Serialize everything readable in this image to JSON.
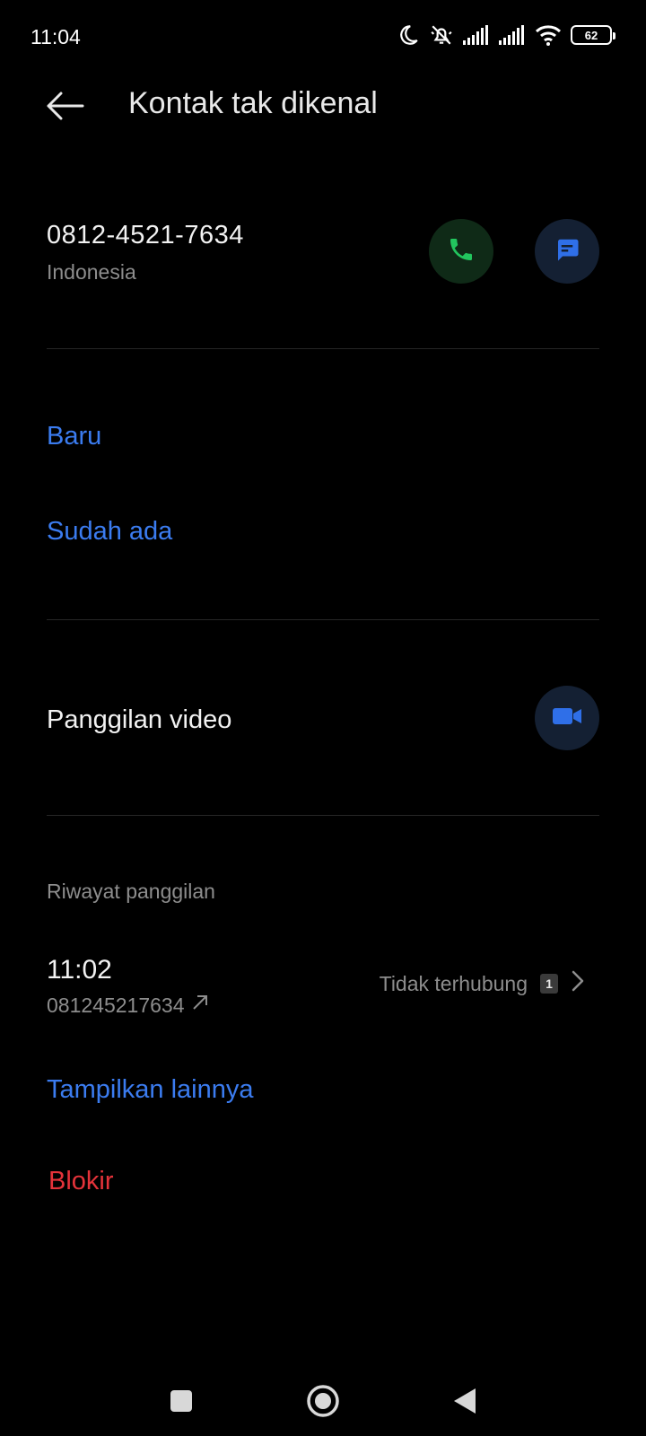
{
  "status_bar": {
    "time": "11:04",
    "battery": "62",
    "icons": [
      "moon-icon",
      "silent-icon",
      "signal-icon",
      "signal-icon",
      "wifi-icon",
      "battery-icon"
    ]
  },
  "header": {
    "title": "Kontak tak dikenal",
    "back_icon": "arrow-left-icon"
  },
  "contact": {
    "number": "0812-4521-7634",
    "region": "Indonesia",
    "call_icon": "phone-icon",
    "message_icon": "message-icon"
  },
  "add_options": {
    "new_label": "Baru",
    "existing_label": "Sudah ada"
  },
  "video_call": {
    "label": "Panggilan video",
    "icon": "video-icon"
  },
  "call_history": {
    "header": "Riwayat panggilan",
    "entries": [
      {
        "time": "11:02",
        "number": "081245217634",
        "direction_icon": "outgoing-arrow-icon",
        "status": "Tidak terhubung",
        "count": "1"
      }
    ],
    "show_more_label": "Tampilkan lainnya"
  },
  "block_label": "Blokir",
  "colors": {
    "background": "#000000",
    "link": "#3b7cf0",
    "danger": "#e5333a",
    "call_green": "#22c55e",
    "accent_blue": "#2f6fe8"
  },
  "nav_bar": {
    "icons": [
      "recents-square-icon",
      "home-circle-icon",
      "back-triangle-icon"
    ]
  }
}
